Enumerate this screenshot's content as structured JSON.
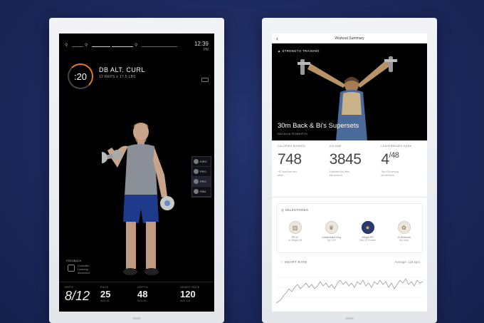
{
  "left_device": {
    "clock": {
      "time": "12:39",
      "sub": "PM"
    },
    "timer": ":20",
    "exercise": {
      "title": "DB ALT. CURL",
      "detail": "12 REPS x 17.5 LBS"
    },
    "leaderboard": [
      {
        "name": "KIRO"
      },
      {
        "name": "PRO"
      },
      {
        "name": "PRO"
      },
      {
        "name": "PAN"
      }
    ],
    "feedback": {
      "label": "FEEDBACK",
      "text_1": "Controlled",
      "text_2": "Lowering",
      "text_3": "Movement"
    },
    "stats": {
      "reps": {
        "label": "REPS",
        "value": "8/12"
      },
      "pace": {
        "label": "PACE",
        "value": "25",
        "sub": "AVG 26"
      },
      "depth": {
        "label": "DEPTH",
        "value": "48",
        "sub": "AVG 46"
      },
      "heart_rate": {
        "label": "HEART RATE",
        "value": "120",
        "sub": "AVG 118"
      }
    }
  },
  "right_device": {
    "nav_title": "Workout Summary",
    "tag": "STRENGTH TRAINING",
    "workout_title": "30m Back & Bi's Supersets",
    "trainer": "NATALIA ROBERTS",
    "metrics": [
      {
        "label": "CALORIES BURNED",
        "value": "748",
        "note_1": "+57 kcal from last",
        "note_2": "week"
      },
      {
        "label": "VOLUME",
        "value": "3845",
        "note_1": "Estimated lbs lifted",
        "note_2": "this workout"
      },
      {
        "label": "LEADERBOARD RANK",
        "value": "4",
        "value_sup": "/48",
        "note_1": "Top 10% among",
        "note_2": "all members"
      }
    ],
    "milestones": {
      "label": "MILESTONES",
      "items": [
        {
          "icon": "bar-icon",
          "t1": "PR #1",
          "t2": "on Weight Lift"
        },
        {
          "icon": "trophy-icon",
          "t1": "Leaderboard King",
          "t2": "Top 10%"
        },
        {
          "icon": "star-medal-icon",
          "t1": "Weight PR",
          "t2": "New 25 Pounds"
        },
        {
          "icon": "ribbon-icon",
          "t1": "10 Workouts",
          "t2": "this week"
        }
      ]
    },
    "heart_rate": {
      "label": "HEART RATE",
      "avg": "Average: 118 bpm"
    }
  },
  "colors": {
    "background": "#1d2a5e",
    "accent": "#e07a2a",
    "badge_dark": "#2c3a6e"
  }
}
